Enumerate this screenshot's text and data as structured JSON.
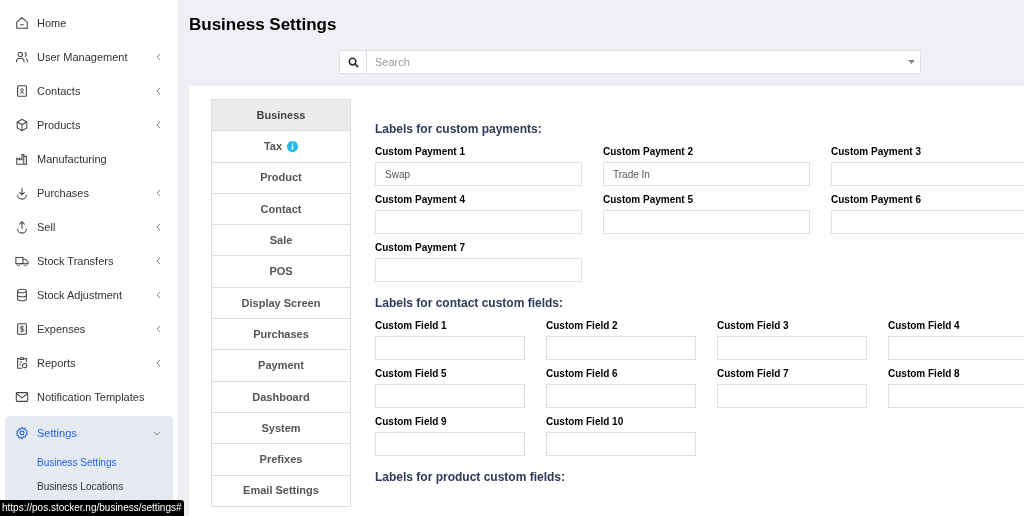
{
  "sidebar": {
    "items": [
      {
        "label": "Home",
        "selected": false
      },
      {
        "label": "User Management",
        "selected": false,
        "expanded": false
      },
      {
        "label": "Contacts",
        "selected": false,
        "expanded": false
      },
      {
        "label": "Products",
        "selected": false,
        "expanded": false
      },
      {
        "label": "Manufacturing",
        "selected": false
      },
      {
        "label": "Purchases",
        "selected": false,
        "expanded": false
      },
      {
        "label": "Sell",
        "selected": false,
        "expanded": false
      },
      {
        "label": "Stock Transfers",
        "selected": false,
        "expanded": false
      },
      {
        "label": "Stock Adjustment",
        "selected": false,
        "expanded": false
      },
      {
        "label": "Expenses",
        "selected": false,
        "expanded": false
      },
      {
        "label": "Reports",
        "selected": false,
        "expanded": false
      },
      {
        "label": "Notification Templates",
        "selected": false
      },
      {
        "label": "Settings",
        "selected": true,
        "expanded": true,
        "children": [
          {
            "label": "Business Settings",
            "selected": true
          },
          {
            "label": "Business Locations",
            "selected": false
          }
        ]
      }
    ]
  },
  "page_title": "Business Settings",
  "search": {
    "placeholder": "Search"
  },
  "tabs": [
    {
      "label": "Business",
      "selected": true
    },
    {
      "label": "Tax",
      "selected": false,
      "info": true
    },
    {
      "label": "Product",
      "selected": false
    },
    {
      "label": "Contact",
      "selected": false
    },
    {
      "label": "Sale",
      "selected": false
    },
    {
      "label": "POS",
      "selected": false
    },
    {
      "label": "Display Screen",
      "selected": false
    },
    {
      "label": "Purchases",
      "selected": false
    },
    {
      "label": "Payment",
      "selected": false
    },
    {
      "label": "Dashboard",
      "selected": false
    },
    {
      "label": "System",
      "selected": false
    },
    {
      "label": "Prefixes",
      "selected": false
    },
    {
      "label": "Email Settings",
      "selected": false
    }
  ],
  "sections": [
    {
      "heading": "Labels for custom payments:",
      "fields": [
        {
          "label": "Custom Payment 1",
          "value": "Swap"
        },
        {
          "label": "Custom Payment 2",
          "value": "Trade In"
        },
        {
          "label": "Custom Payment 3"
        },
        {
          "label": "Custom Payment 4"
        },
        {
          "label": "Custom Payment 5"
        },
        {
          "label": "Custom Payment 6"
        },
        {
          "label": "Custom Payment 7"
        }
      ]
    },
    {
      "heading": "Labels for contact custom fields:",
      "fields": [
        {
          "label": "Custom Field 1"
        },
        {
          "label": "Custom Field 2"
        },
        {
          "label": "Custom Field 3"
        },
        {
          "label": "Custom Field 4"
        },
        {
          "label": "Custom Field 5"
        },
        {
          "label": "Custom Field 6"
        },
        {
          "label": "Custom Field 7"
        },
        {
          "label": "Custom Field 8"
        },
        {
          "label": "Custom Field 9"
        },
        {
          "label": "Custom Field 10"
        }
      ]
    },
    {
      "heading": "Labels for product custom fields:"
    }
  ],
  "status_url": "https://pos.stocker.ng/business/settings#"
}
